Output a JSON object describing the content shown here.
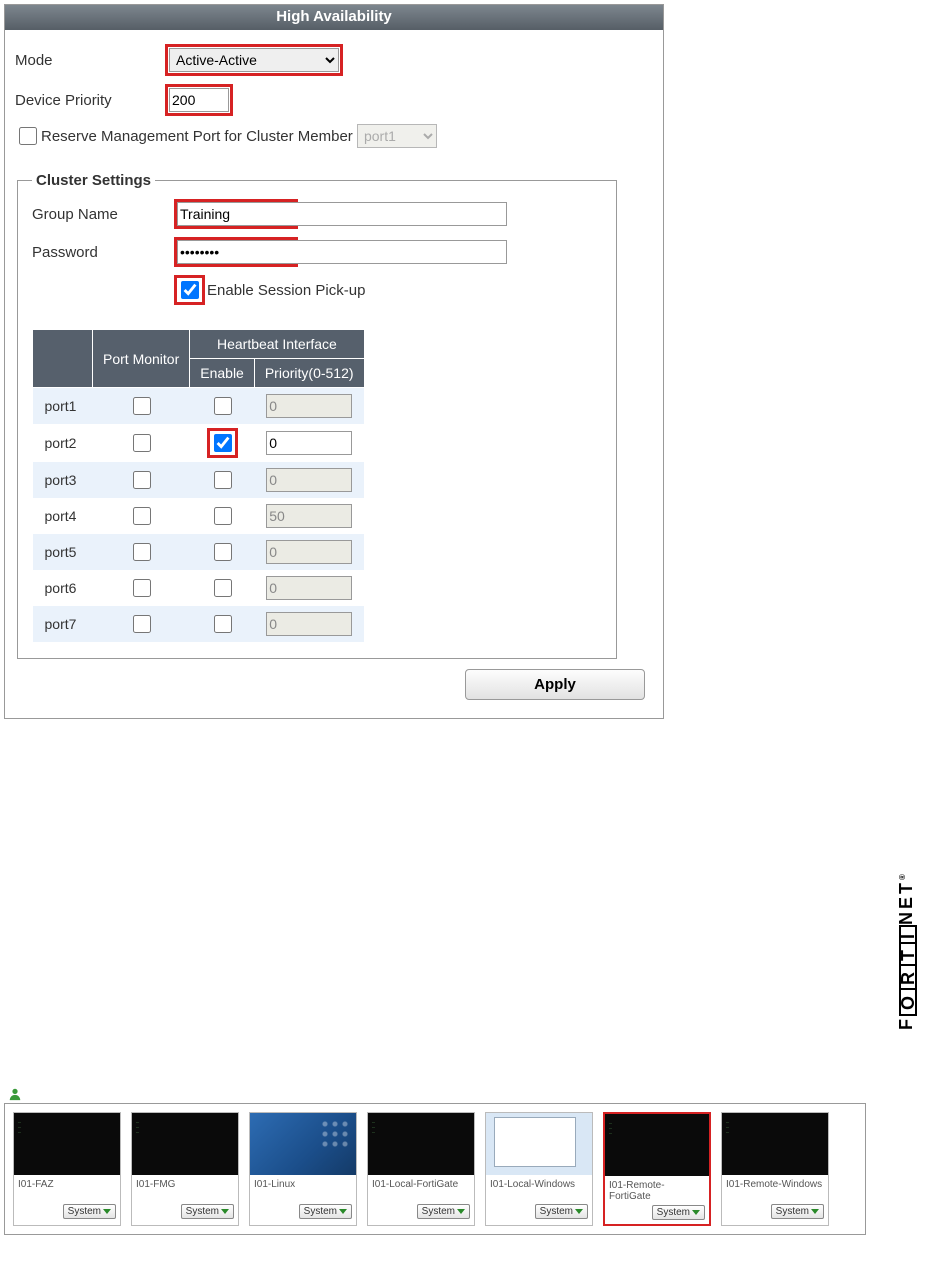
{
  "panel": {
    "title": "High Availability",
    "mode_label": "Mode",
    "mode_value": "Active-Active",
    "priority_label": "Device Priority",
    "priority_value": "200",
    "reserve_label": "Reserve Management Port for Cluster Member",
    "reserve_checked": false,
    "reserve_port": "port1"
  },
  "cluster": {
    "legend": "Cluster Settings",
    "group_label": "Group Name",
    "group_value": "Training",
    "password_label": "Password",
    "password_value": "••••••••",
    "session_pickup_label": "Enable Session Pick-up",
    "session_pickup_checked": true
  },
  "table": {
    "headers": {
      "port_monitor": "Port Monitor",
      "heartbeat": "Heartbeat Interface",
      "enable": "Enable",
      "priority": "Priority(0-512)"
    },
    "rows": [
      {
        "port": "port1",
        "monitor": false,
        "hb_enable": false,
        "priority": "0",
        "enabled": false,
        "highlight": false
      },
      {
        "port": "port2",
        "monitor": false,
        "hb_enable": true,
        "priority": "0",
        "enabled": true,
        "highlight": true
      },
      {
        "port": "port3",
        "monitor": false,
        "hb_enable": false,
        "priority": "0",
        "enabled": false,
        "highlight": false
      },
      {
        "port": "port4",
        "monitor": false,
        "hb_enable": false,
        "priority": "50",
        "enabled": false,
        "highlight": false
      },
      {
        "port": "port5",
        "monitor": false,
        "hb_enable": false,
        "priority": "0",
        "enabled": false,
        "highlight": false
      },
      {
        "port": "port6",
        "monitor": false,
        "hb_enable": false,
        "priority": "0",
        "enabled": false,
        "highlight": false
      },
      {
        "port": "port7",
        "monitor": false,
        "hb_enable": false,
        "priority": "0",
        "enabled": false,
        "highlight": false
      }
    ]
  },
  "buttons": {
    "apply": "Apply",
    "system": "System"
  },
  "vms": [
    {
      "label": "I01-FAZ",
      "thumb": "black",
      "selected": false
    },
    {
      "label": "I01-FMG",
      "thumb": "black",
      "selected": false
    },
    {
      "label": "I01-Linux",
      "thumb": "blue",
      "selected": false
    },
    {
      "label": "I01-Local-FortiGate",
      "thumb": "black",
      "selected": false
    },
    {
      "label": "I01-Local-Windows",
      "thumb": "win",
      "selected": false
    },
    {
      "label": "I01-Remote-FortiGate",
      "thumb": "black",
      "selected": true
    },
    {
      "label": "I01-Remote-Windows",
      "thumb": "black",
      "selected": false
    }
  ],
  "brand": "FORTINET"
}
